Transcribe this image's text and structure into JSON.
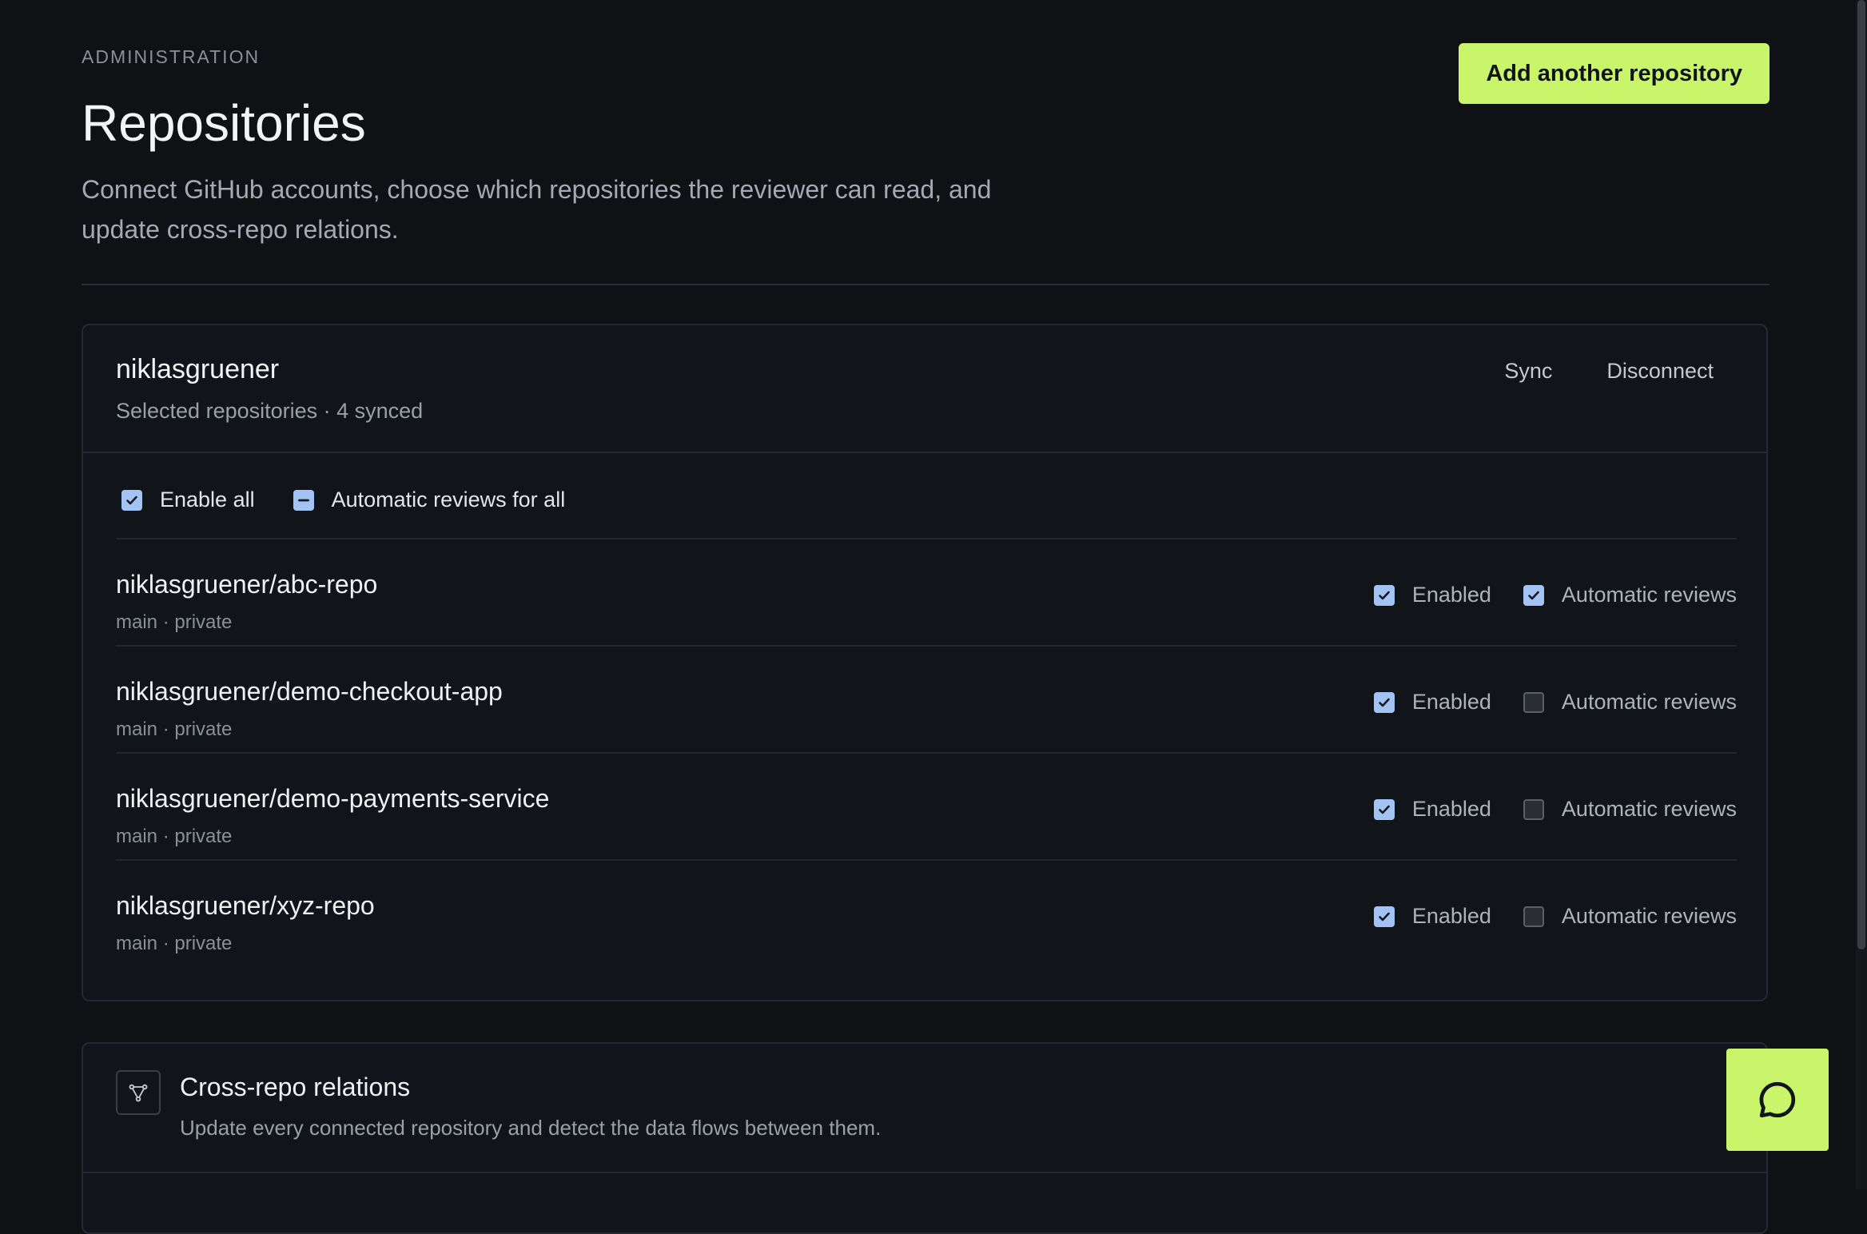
{
  "header": {
    "eyebrow": "ADMINISTRATION",
    "title": "Repositories",
    "description": "Connect GitHub accounts, choose which repositories the reviewer can read, and update cross-repo relations.",
    "add_button": "Add another repository"
  },
  "account": {
    "name": "niklasgruener",
    "subtitle": "Selected repositories · 4 synced",
    "sync_label": "Sync",
    "disconnect_label": "Disconnect",
    "bulk": {
      "enable_all": {
        "label": "Enable all",
        "state": "checked"
      },
      "auto_reviews_all": {
        "label": "Automatic reviews for all",
        "state": "indeterminate"
      }
    },
    "repos": [
      {
        "name": "niklasgruener/abc-repo",
        "meta": "main · private",
        "enabled_label": "Enabled",
        "enabled": true,
        "auto_label": "Automatic reviews",
        "auto": true
      },
      {
        "name": "niklasgruener/demo-checkout-app",
        "meta": "main · private",
        "enabled_label": "Enabled",
        "enabled": true,
        "auto_label": "Automatic reviews",
        "auto": false
      },
      {
        "name": "niklasgruener/demo-payments-service",
        "meta": "main · private",
        "enabled_label": "Enabled",
        "enabled": true,
        "auto_label": "Automatic reviews",
        "auto": false
      },
      {
        "name": "niklasgruener/xyz-repo",
        "meta": "main · private",
        "enabled_label": "Enabled",
        "enabled": true,
        "auto_label": "Automatic reviews",
        "auto": false
      }
    ]
  },
  "relations": {
    "title": "Cross-repo relations",
    "subtitle": "Update every connected repository and detect the data flows between them.",
    "icon": "graph-icon"
  },
  "chat": {
    "icon": "chat-bubble-icon"
  },
  "colors": {
    "accent": "#c8f56a",
    "checkbox_on": "#a4c3f5",
    "background": "#0f1114"
  }
}
